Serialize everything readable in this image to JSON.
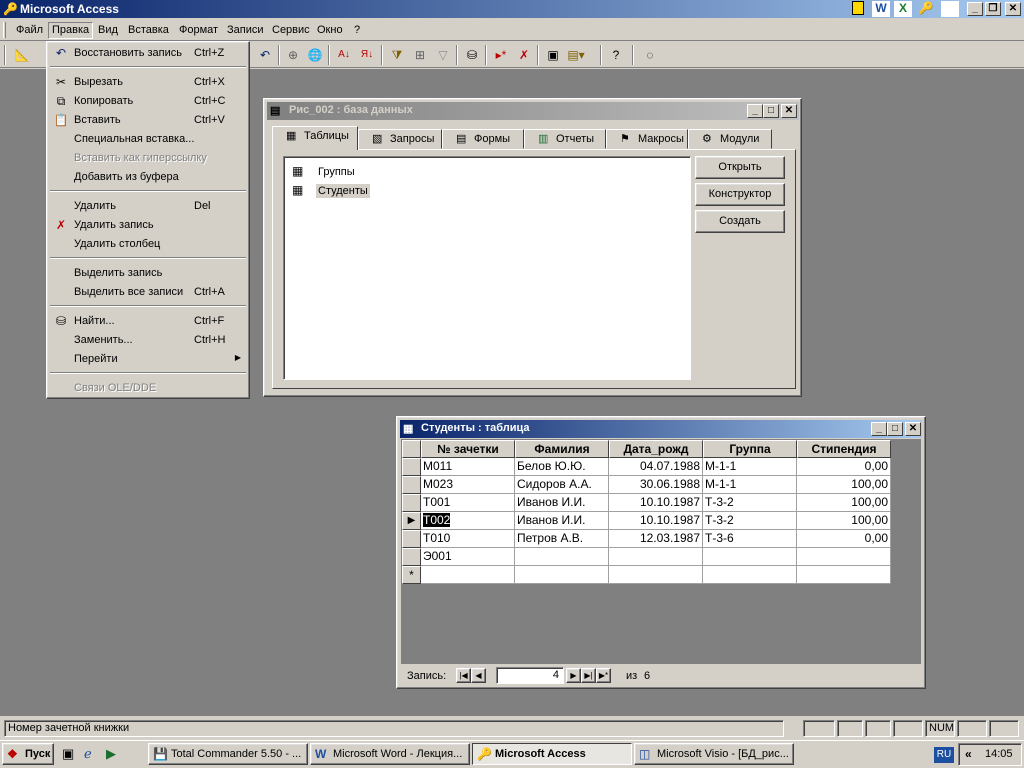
{
  "app": {
    "title": "Microsoft Access"
  },
  "menubar": {
    "items": [
      "Файл",
      "Правка",
      "Вид",
      "Вставка",
      "Формат",
      "Записи",
      "Сервис",
      "Окно",
      "?"
    ]
  },
  "edit_menu": {
    "items": [
      {
        "label": "Восстановить запись",
        "shortcut": "Ctrl+Z",
        "icon": "undo-icon"
      },
      {
        "label": "Вырезать",
        "shortcut": "Ctrl+X",
        "icon": "scissors-icon"
      },
      {
        "label": "Копировать",
        "shortcut": "Ctrl+C",
        "icon": "copy-icon"
      },
      {
        "label": "Вставить",
        "shortcut": "Ctrl+V",
        "icon": "paste-icon"
      },
      {
        "label": "Специальная вставка...",
        "shortcut": ""
      },
      {
        "label": "Вставить как гиперссылку",
        "shortcut": "",
        "disabled": true
      },
      {
        "label": "Добавить из буфера",
        "shortcut": ""
      },
      {
        "label": "Удалить",
        "shortcut": "Del"
      },
      {
        "label": "Удалить запись",
        "shortcut": "",
        "icon": "delete-record-icon"
      },
      {
        "label": "Удалить столбец",
        "shortcut": ""
      },
      {
        "label": "Выделить запись",
        "shortcut": ""
      },
      {
        "label": "Выделить все записи",
        "shortcut": "Ctrl+A"
      },
      {
        "label": "Найти...",
        "shortcut": "Ctrl+F",
        "icon": "binoculars-icon"
      },
      {
        "label": "Заменить...",
        "shortcut": "Ctrl+H"
      },
      {
        "label": "Перейти",
        "shortcut": "",
        "submenu": true
      },
      {
        "label": "Связи OLE/DDE",
        "shortcut": "",
        "disabled": true
      }
    ]
  },
  "db_window": {
    "title": "Рис_002 : база данных",
    "tabs": [
      "Таблицы",
      "Запросы",
      "Формы",
      "Отчеты",
      "Макросы",
      "Модули"
    ],
    "objects": [
      "Группы",
      "Студенты"
    ],
    "buttons": [
      "Открыть",
      "Конструктор",
      "Создать"
    ]
  },
  "table_window": {
    "title": "Студенты : таблица",
    "columns": [
      "№ зачетки",
      "Фамилия",
      "Дата_рожд",
      "Группа",
      "Стипендия"
    ],
    "rows": [
      [
        "М011",
        "Белов Ю.Ю.",
        "04.07.1988",
        "М-1-1",
        "0,00"
      ],
      [
        "М023",
        "Сидоров А.А.",
        "30.06.1988",
        "М-1-1",
        "100,00"
      ],
      [
        "Т001",
        "Иванов И.И.",
        "10.10.1987",
        "Т-3-2",
        "100,00"
      ],
      [
        "Т002",
        "Иванов И.И.",
        "10.10.1987",
        "Т-3-2",
        "100,00"
      ],
      [
        "Т010",
        "Петров А.В.",
        "12.03.1987",
        "Т-3-6",
        "0,00"
      ],
      [
        "Э001",
        "",
        "",
        "",
        ""
      ]
    ],
    "current_row": 4,
    "nav": {
      "label": "Запись:",
      "current": "4",
      "of": "из",
      "total": "6"
    }
  },
  "status_bar": {
    "text": "Номер зачетной книжки",
    "num": "NUM"
  },
  "taskbar": {
    "start": "Пуск",
    "tasks": [
      "Total Commander 5.50 - ...",
      "Microsoft Word - Лекция...",
      "Microsoft Access",
      "Microsoft Visio - [БД_рис..."
    ],
    "lang": "RU",
    "time": "14:05"
  }
}
